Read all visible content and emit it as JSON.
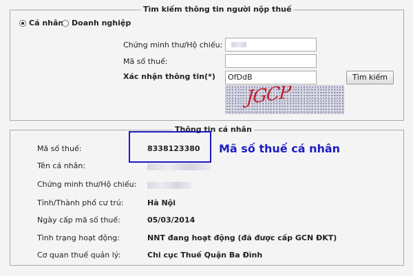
{
  "search": {
    "legend": "Tìm kiếm thông tin người nộp thuế",
    "options": [
      {
        "label": "Cá nhân",
        "checked": true
      },
      {
        "label": "Doanh nghiệp",
        "checked": false
      }
    ],
    "id_label": "Chứng minh thư/Hộ chiếu:",
    "tax_code_label": "Mã số thuế:",
    "captcha_label": "Xác nhận thông tin(*)",
    "captcha_value": "OfDdB",
    "captcha_image_text": "JGCP",
    "search_button": "Tìm kiếm"
  },
  "info": {
    "legend": "Thông tin cá nhân",
    "rows": [
      {
        "label": "Mã số thuế:",
        "value": "8338123380"
      },
      {
        "label": "Tên cá nhân:",
        "value": ""
      },
      {
        "label": "Chứng minh thư/Hộ chiếu:",
        "value": ""
      },
      {
        "label": "Tỉnh/Thành phố cư trú:",
        "value": "Hà Nội"
      },
      {
        "label": "Ngày cấp mã số thuế:",
        "value": "05/03/2014"
      },
      {
        "label": "Tình trạng hoạt động:",
        "value": "NNT đang hoạt động (đã được cấp GCN ĐKT)"
      },
      {
        "label": "Cơ quan thuế quản lý:",
        "value": "Chi cục Thuế Quận Ba Đình"
      }
    ]
  },
  "annotation": {
    "text": "Mã số thuế cá nhân",
    "color": "#1d1cc4"
  }
}
